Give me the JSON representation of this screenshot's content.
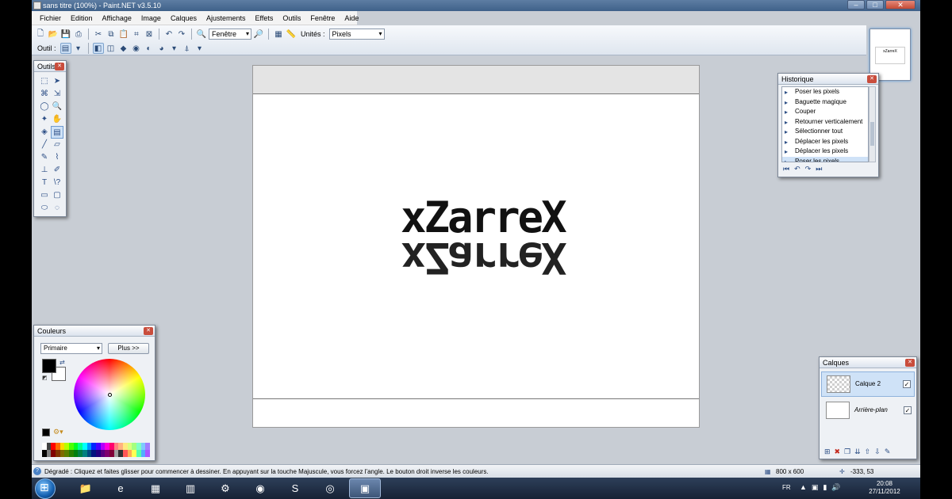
{
  "window": {
    "title": "sans titre (100%) - Paint.NET v3.5.10",
    "controls": [
      "–",
      "□",
      "✕"
    ]
  },
  "menu": [
    "Fichier",
    "Edition",
    "Affichage",
    "Image",
    "Calques",
    "Ajustements",
    "Effets",
    "Outils",
    "Fenêtre",
    "Aide"
  ],
  "toolbar": {
    "zoom_value": "Fenêtre",
    "units_label": "Unités :",
    "units_value": "Pixels",
    "tool_label": "Outil :"
  },
  "canvas": {
    "text": "xZarreX"
  },
  "tools_panel": {
    "title": "Outils",
    "tools": [
      {
        "name": "rectangle-select-tool",
        "glyph": "⬚"
      },
      {
        "name": "move-selection-tool",
        "glyph": "➤"
      },
      {
        "name": "lasso-select-tool",
        "glyph": "⌘"
      },
      {
        "name": "move-selected-tool",
        "glyph": "⇲"
      },
      {
        "name": "ellipse-select-tool",
        "glyph": "◯"
      },
      {
        "name": "zoom-tool",
        "glyph": "🔍"
      },
      {
        "name": "magic-wand-tool",
        "glyph": "✦"
      },
      {
        "name": "pan-tool",
        "glyph": "✋"
      },
      {
        "name": "paint-bucket-tool",
        "glyph": "◈"
      },
      {
        "name": "gradient-tool",
        "glyph": "▤"
      },
      {
        "name": "paintbrush-tool",
        "glyph": "╱"
      },
      {
        "name": "eraser-tool",
        "glyph": "▱"
      },
      {
        "name": "pencil-tool",
        "glyph": "✎"
      },
      {
        "name": "color-picker-tool",
        "glyph": "⌇"
      },
      {
        "name": "clone-stamp-tool",
        "glyph": "⊥"
      },
      {
        "name": "recolor-tool",
        "glyph": "✐"
      },
      {
        "name": "text-tool",
        "glyph": "T"
      },
      {
        "name": "line-curve-tool",
        "glyph": "\\?"
      },
      {
        "name": "rectangle-tool",
        "glyph": "▭"
      },
      {
        "name": "rounded-rectangle-tool",
        "glyph": "▢"
      },
      {
        "name": "ellipse-tool",
        "glyph": "⬭"
      },
      {
        "name": "freeform-shape-tool",
        "glyph": "◌"
      }
    ]
  },
  "history_panel": {
    "title": "Historique",
    "items": [
      "Poser les pixels",
      "Baguette magique",
      "Couper",
      "Retourner verticalement",
      "Sélectionner tout",
      "Déplacer les pixels",
      "Déplacer les pixels",
      "Poser les pixels"
    ]
  },
  "colors_panel": {
    "title": "Couleurs",
    "mode": "Primaire",
    "more_button": "Plus >>",
    "primary_color": "#000000",
    "secondary_color": "#ffffff",
    "palette_top": [
      "#ffffff",
      "#404040",
      "#ff0000",
      "#ff6a00",
      "#ffd800",
      "#b6ff00",
      "#4cff00",
      "#00ff21",
      "#00ff90",
      "#00ffff",
      "#0094ff",
      "#0026ff",
      "#4800ff",
      "#b200ff",
      "#ff00dc",
      "#ff006e",
      "#ff7f7f",
      "#ffb27f",
      "#ffe97f",
      "#daff7f",
      "#a5ff7f",
      "#7fffc5",
      "#7fc9ff",
      "#a17fff"
    ],
    "palette_bottom": [
      "#000000",
      "#808080",
      "#7f0000",
      "#7f3300",
      "#7f6a00",
      "#5b7f00",
      "#267f00",
      "#007f0e",
      "#007f46",
      "#007f7f",
      "#004a7f",
      "#00137f",
      "#21007f",
      "#57007f",
      "#7f006e",
      "#7f0037",
      "#a0a0a0",
      "#303030",
      "#ff5555",
      "#ffaa55",
      "#ffff55",
      "#55ffaa",
      "#55aaff",
      "#aa55ff"
    ]
  },
  "layers_panel": {
    "title": "Calques",
    "layers": [
      {
        "name": "Calque 2",
        "visible": true,
        "selected": true
      },
      {
        "name": "Arrière-plan",
        "visible": true,
        "selected": false
      }
    ]
  },
  "status_bar": {
    "message": "Dégradé : Cliquez et faites glisser pour commencer à dessiner. En appuyant sur la touche Majuscule, vous forcez l'angle. Le bouton droit inverse les couleurs.",
    "image_size": "800 x 600",
    "cursor_position": "-333, 53"
  },
  "taskbar": {
    "apps": [
      {
        "name": "explorer",
        "glyph": "📁",
        "active": false
      },
      {
        "name": "internet-explorer",
        "glyph": "e",
        "active": false
      },
      {
        "name": "minecraft",
        "glyph": "▦",
        "active": false
      },
      {
        "name": "winrar",
        "glyph": "▥",
        "active": false
      },
      {
        "name": "tool-app",
        "glyph": "⚙",
        "active": false
      },
      {
        "name": "blender",
        "glyph": "◉",
        "active": false
      },
      {
        "name": "skype",
        "glyph": "S",
        "active": false
      },
      {
        "name": "chrome",
        "glyph": "◎",
        "active": false
      },
      {
        "name": "paint-net",
        "glyph": "▣",
        "active": true
      }
    ],
    "language": "FR",
    "time": "20:08",
    "date": "27/11/2012"
  }
}
